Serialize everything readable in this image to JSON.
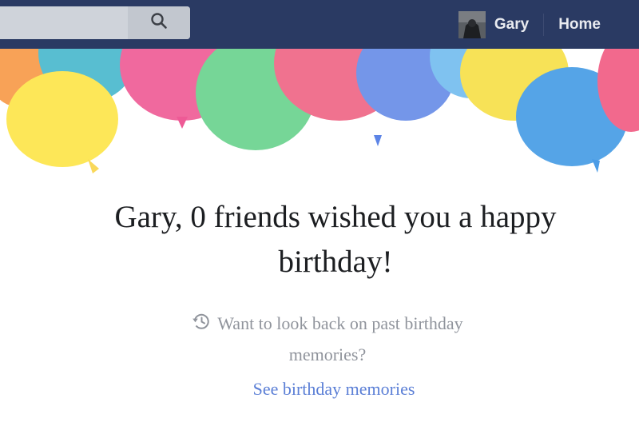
{
  "header": {
    "search": {
      "value": "",
      "placeholder": ""
    },
    "user_name": "Gary",
    "home_label": "Home"
  },
  "birthday": {
    "headline_line1": "Gary, 0 friends wished you a happy",
    "headline_line2": "birthday!",
    "memories_line1": "Want to look back on past birthday",
    "memories_line2": "memories?",
    "memories_link": "See birthday memories"
  },
  "icons": {
    "search": "search-icon",
    "history": "history-icon"
  },
  "colors": {
    "header_bg": "#2a3a63",
    "headline": "#1c1e21",
    "muted_text": "#90949c",
    "link": "#5b7fd6"
  }
}
